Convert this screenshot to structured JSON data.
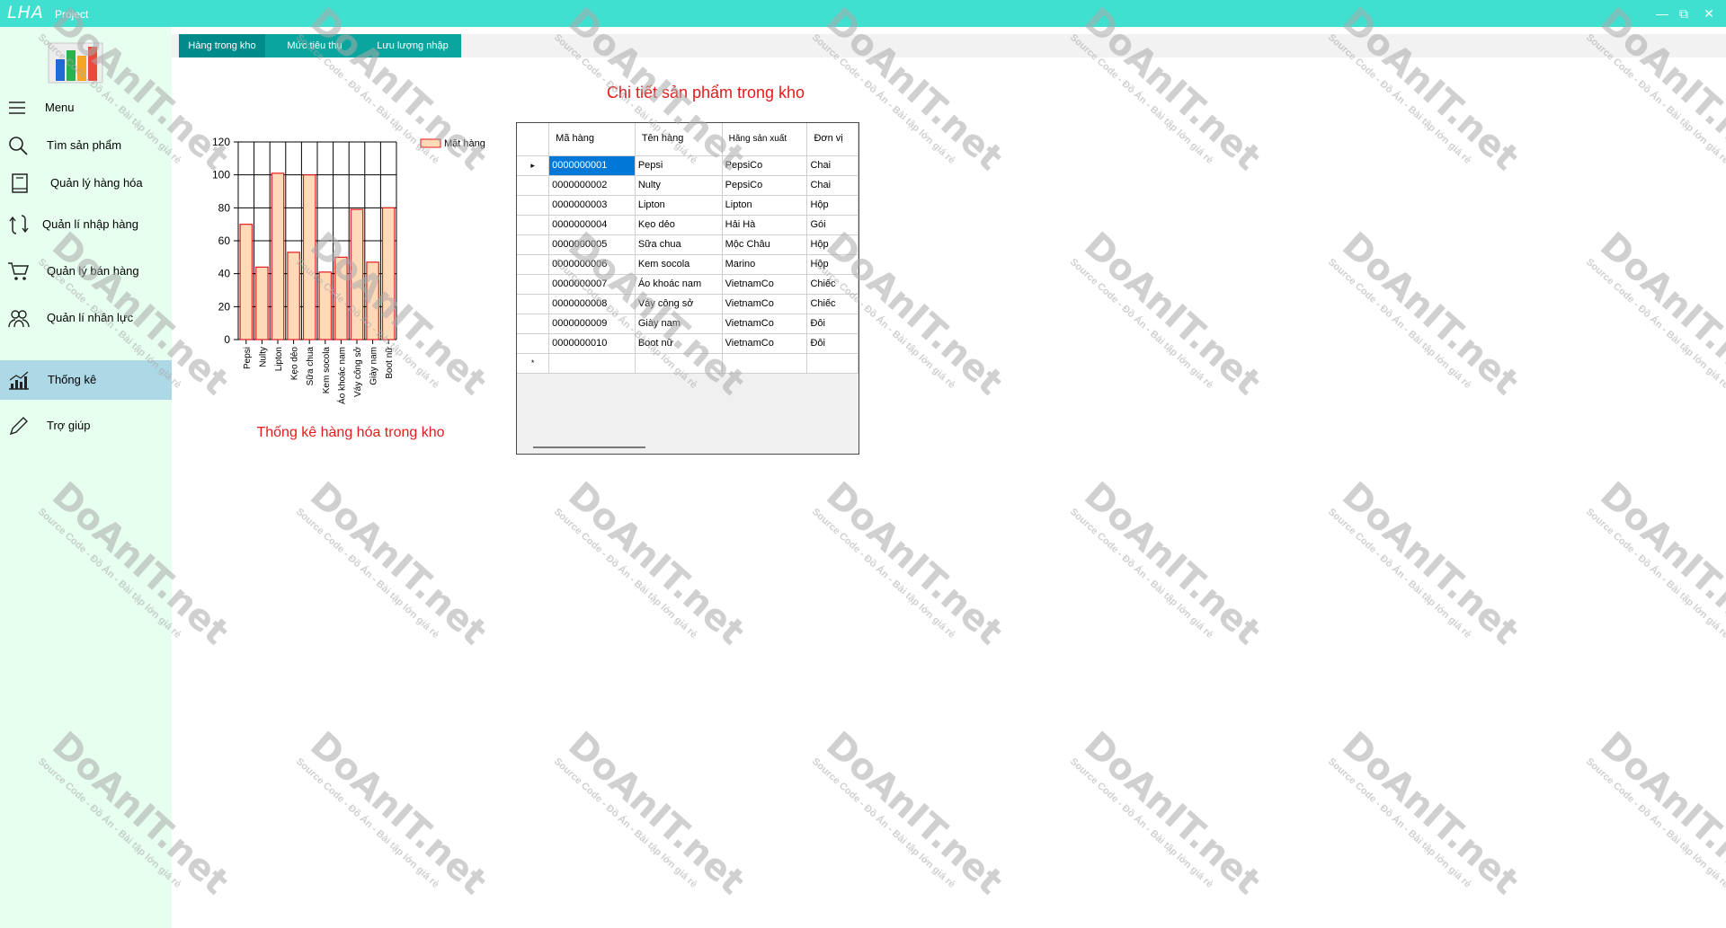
{
  "window": {
    "title": "LHA",
    "subtitle": "Project",
    "buttons": {
      "minimize": "—",
      "restore": "⧉",
      "close": "✕"
    }
  },
  "sidebar": {
    "items": [
      {
        "label": "Menu",
        "icon": "hamburger-icon"
      },
      {
        "label": "Tìm sản phẩm",
        "icon": "search-icon"
      },
      {
        "label": "Quản lý hàng hóa",
        "icon": "book-icon"
      },
      {
        "label": "Quản lí nhập hàng",
        "icon": "refresh-icon"
      },
      {
        "label": "Quản lý bán hàng",
        "icon": "cart-icon"
      },
      {
        "label": "Quản lí nhân lực",
        "icon": "users-icon"
      },
      {
        "label": "Thống kê",
        "icon": "chart-icon",
        "active": true
      },
      {
        "label": "Trợ giúp",
        "icon": "pencil-icon"
      }
    ]
  },
  "tabs": [
    {
      "label": "Hàng trong kho",
      "active": true
    },
    {
      "label": "Mức tiêu thụ"
    },
    {
      "label": "Lưu lượng nhập"
    }
  ],
  "chart_data": {
    "type": "bar",
    "title": "Thống kê hàng hóa trong kho",
    "categories": [
      "Pepsi",
      "Nulty",
      "Lipton",
      "Kẹo dẻo",
      "Sữa chua",
      "Kem socola",
      "Áo khoác nam",
      "Váy công sở",
      "Giày nam",
      "Boot nữ"
    ],
    "series": [
      {
        "name": "Mặt hàng",
        "values": [
          70,
          44,
          101,
          53,
          100,
          41,
          50,
          79,
          47,
          80
        ],
        "color": "#FFDAB9",
        "stroke": "#E31B1B"
      }
    ],
    "ylim": [
      0,
      120
    ],
    "yticks": [
      "0",
      "20",
      "40",
      "60",
      "80",
      "100",
      "120"
    ],
    "grid": true,
    "legend": "top-right"
  },
  "grid": {
    "title": "Chi tiết sản phẩm trong kho",
    "columns": [
      "Mã hàng",
      "Tên hàng",
      "Hãng sản xuất",
      "Đơn vị"
    ],
    "rows": [
      [
        "0000000001",
        "Pepsi",
        "PepsiCo",
        "Chai"
      ],
      [
        "0000000002",
        "Nulty",
        "PepsiCo",
        "Chai"
      ],
      [
        "0000000003",
        "Lipton",
        "Lipton",
        "Hộp"
      ],
      [
        "0000000004",
        "Kẹo dẻo",
        "Hải Hà",
        "Gói"
      ],
      [
        "0000000005",
        "Sữa chua",
        "Mộc Châu",
        "Hộp"
      ],
      [
        "0000000006",
        "Kem socola",
        "Marino",
        "Hộp"
      ],
      [
        "0000000007",
        "Áo khoác nam",
        "VietnamCo",
        "Chiếc"
      ],
      [
        "0000000008",
        "Váy công sở",
        "VietnamCo",
        "Chiếc"
      ],
      [
        "0000000009",
        "Giày nam",
        "VietnamCo",
        "Đôi"
      ],
      [
        "0000000010",
        "Boot nữ",
        "VietnamCo",
        "Đôi"
      ]
    ],
    "current_row_marker": "▸",
    "new_row_marker": "*"
  },
  "watermark": {
    "text": "DoAnIT.net",
    "subtext": "Source Code - Đồ Án - Bài tập lớn giá rẻ"
  }
}
